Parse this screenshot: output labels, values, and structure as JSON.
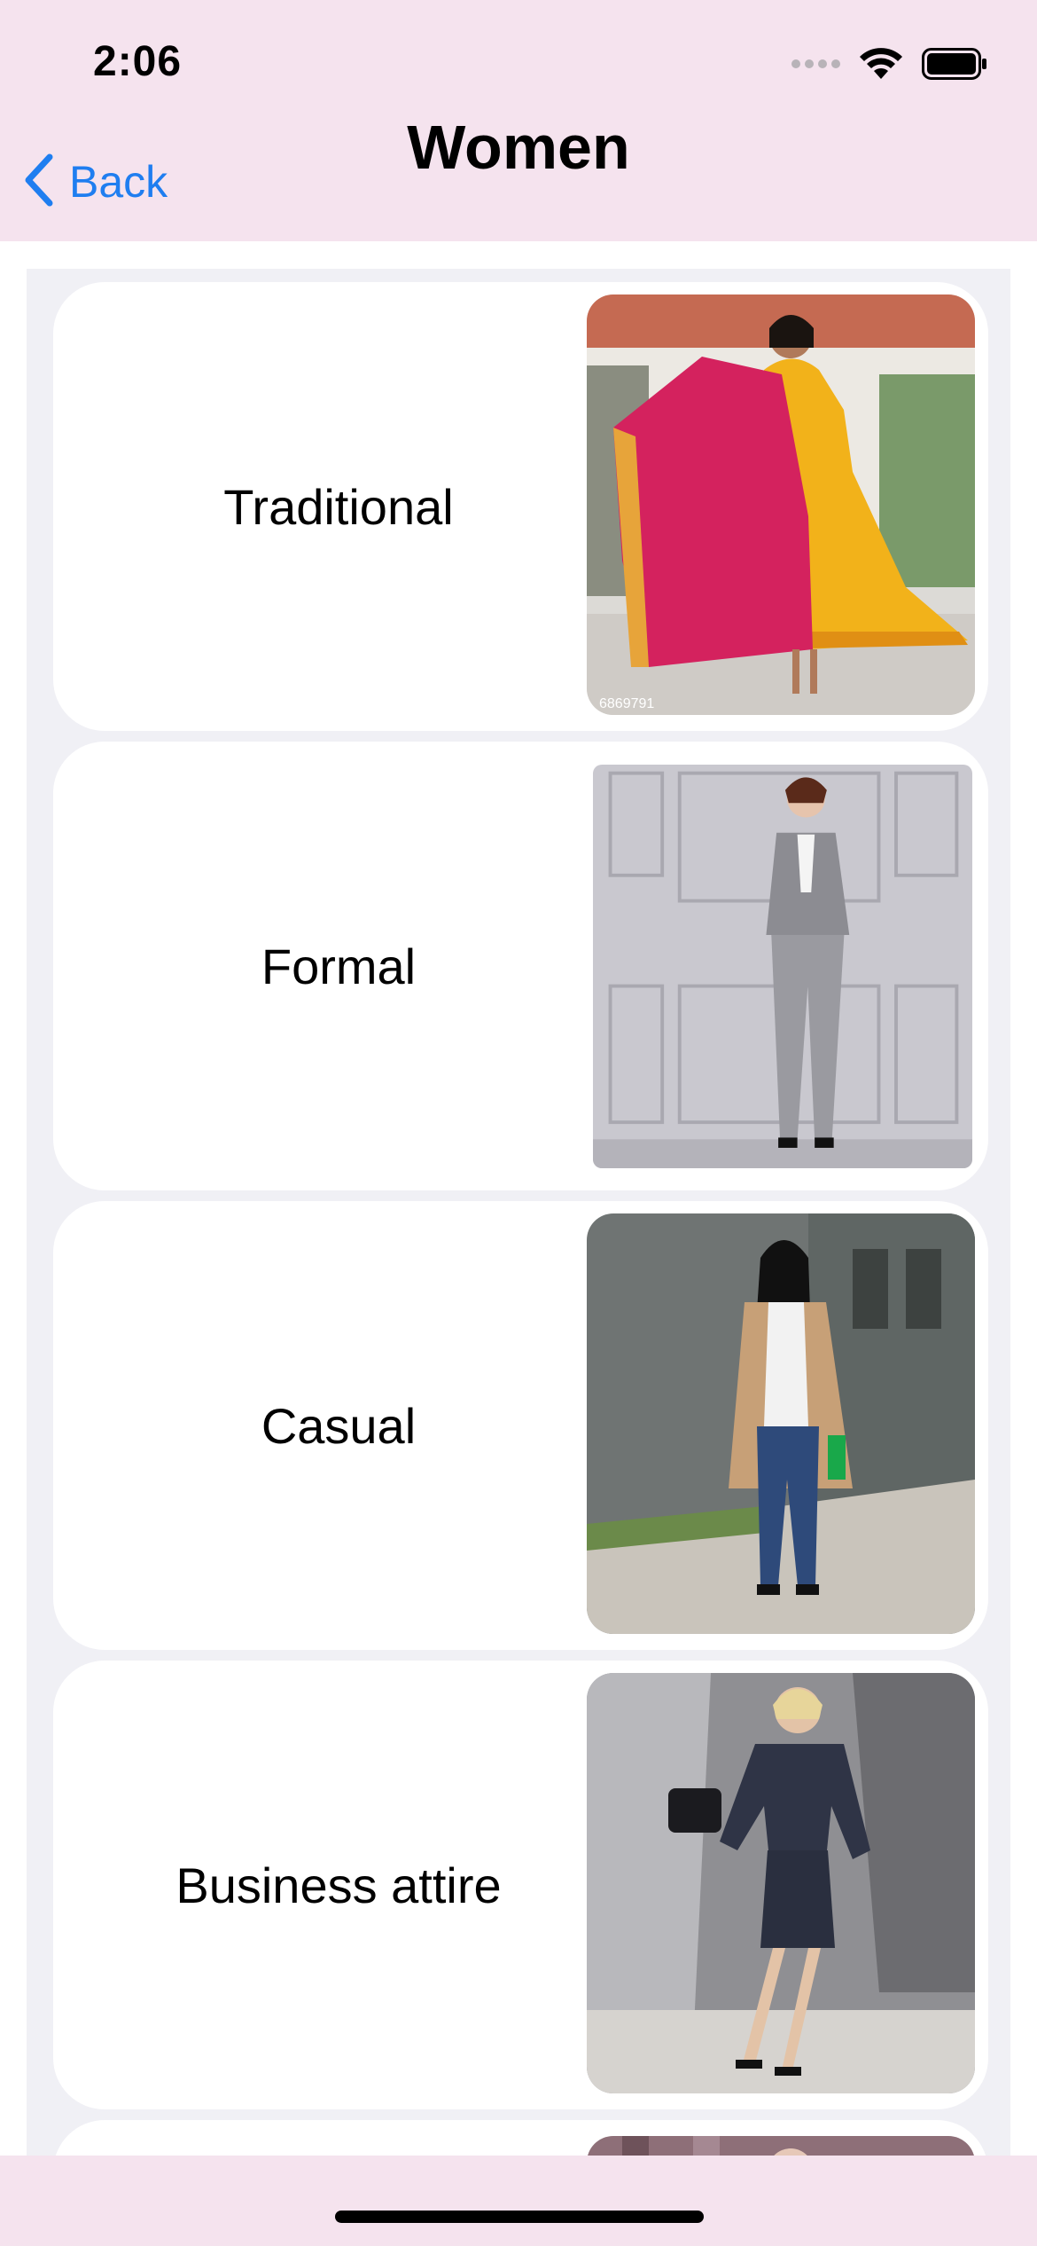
{
  "status_bar": {
    "time": "2:06"
  },
  "nav": {
    "back_label": "Back",
    "title": "Women"
  },
  "categories": [
    {
      "label": "Traditional"
    },
    {
      "label": "Formal"
    },
    {
      "label": "Casual"
    },
    {
      "label": "Business attire"
    }
  ],
  "photo_captions": {
    "traditional": "6869791"
  },
  "colors": {
    "header_bg": "#f5e3ee",
    "list_bg": "#f0f0f5",
    "accent": "#1f7ef0"
  }
}
